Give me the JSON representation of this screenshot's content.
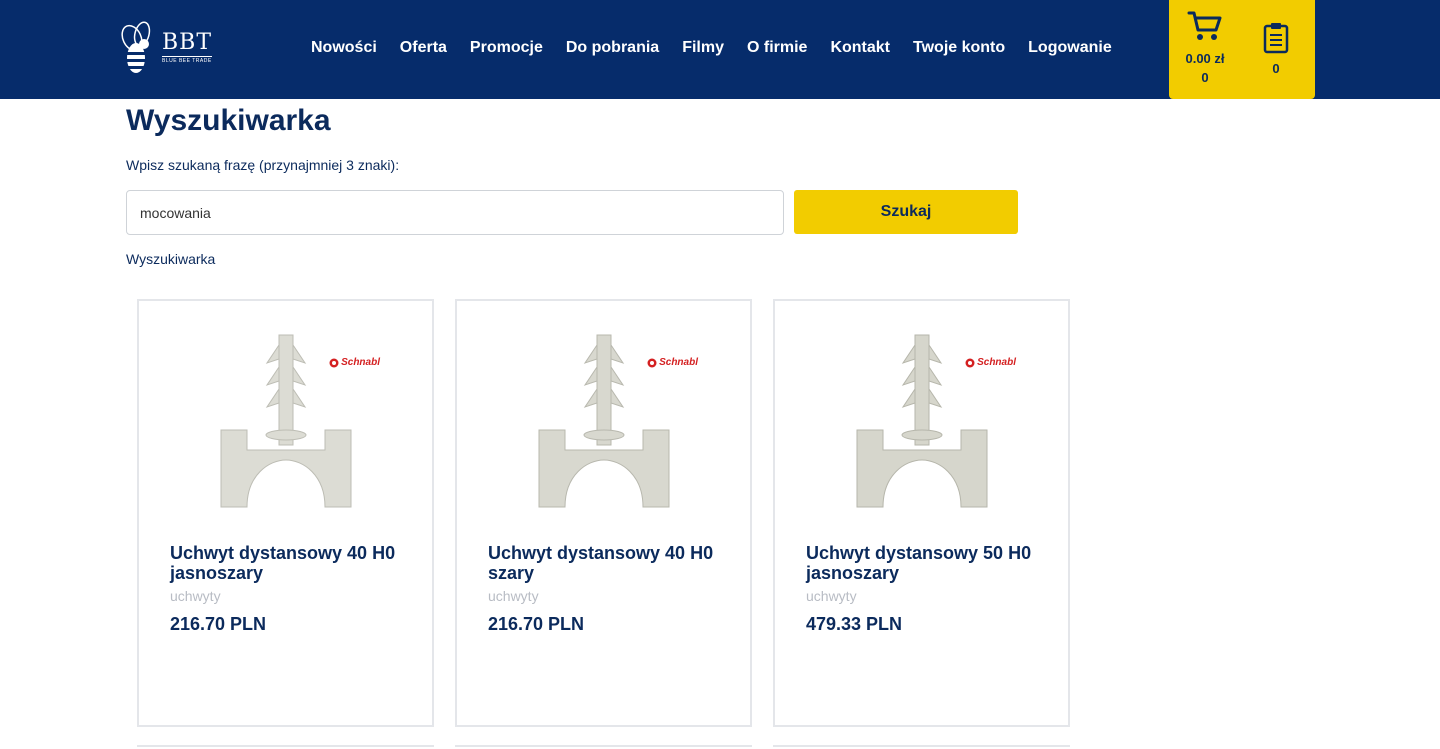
{
  "brand": {
    "logo_text": "BBT",
    "logo_subtext": "BLUE BEE TRADE"
  },
  "nav": {
    "items": [
      "Nowości",
      "Oferta",
      "Promocje",
      "Do pobrania",
      "Filmy",
      "O firmie",
      "Kontakt",
      "Twoje konto",
      "Logowanie"
    ]
  },
  "cart": {
    "total": "0.00 zł",
    "count": "0",
    "icon": "cart-icon"
  },
  "clipboard": {
    "count": "0",
    "icon": "clipboard-icon"
  },
  "search": {
    "title": "Wyszukiwarka",
    "label": "Wpisz szukaną frazę (przynajmniej 3 znaki):",
    "value": "mocowania",
    "button": "Szukaj"
  },
  "breadcrumb": "Wyszukiwarka",
  "products": [
    {
      "title": "Uchwyt dystansowy 40 H0 jasnoszary",
      "category": "uchwyty",
      "price": "216.70 PLN",
      "brand": "Schnabl"
    },
    {
      "title": "Uchwyt dystansowy 40 H0 szary",
      "category": "uchwyty",
      "price": "216.70 PLN",
      "brand": "Schnabl"
    },
    {
      "title": "Uchwyt dystansowy 50 H0 jasnoszary",
      "category": "uchwyty",
      "price": "479.33 PLN",
      "brand": "Schnabl"
    }
  ],
  "colors": {
    "header": "#062c6b",
    "accent": "#f2cc00",
    "text": "#0b2a5c",
    "muted": "#b8bcc4"
  }
}
